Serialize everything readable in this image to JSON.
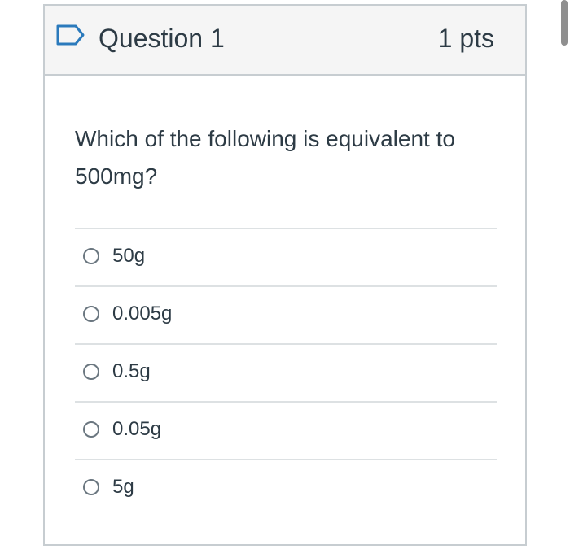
{
  "question": {
    "title": "Question 1",
    "points": "1 pts",
    "text": "Which of the following is equivalent to 500mg?",
    "flag_icon": "flag-outline-icon",
    "accent_color": "#2b7abc"
  },
  "answers": [
    {
      "label": "50g"
    },
    {
      "label": "0.005g"
    },
    {
      "label": "0.5g"
    },
    {
      "label": "0.05g"
    },
    {
      "label": "5g"
    }
  ]
}
